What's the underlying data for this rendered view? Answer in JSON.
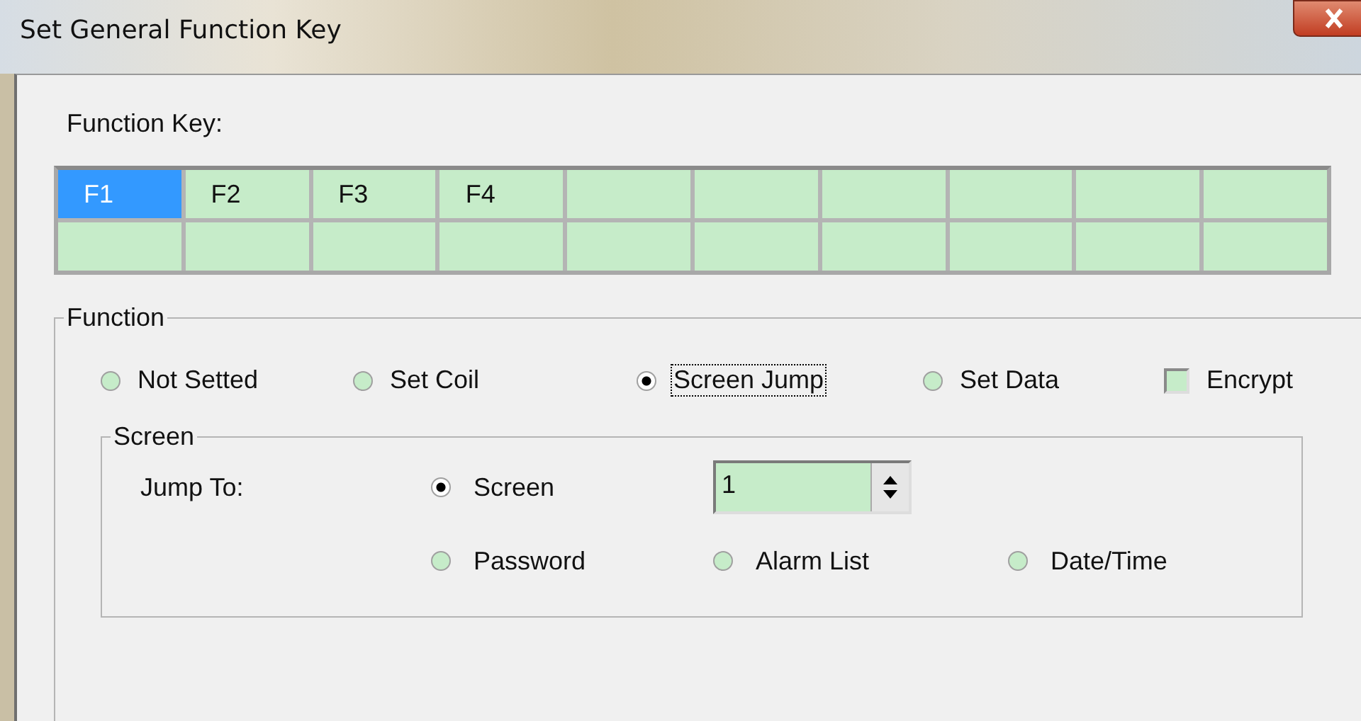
{
  "window": {
    "title": "Set General Function Key"
  },
  "function_key": {
    "label": "Function Key:",
    "rows": [
      [
        {
          "label": "F1",
          "selected": true
        },
        {
          "label": "F2",
          "selected": false
        },
        {
          "label": "F3",
          "selected": false
        },
        {
          "label": "F4",
          "selected": false
        },
        {
          "selected": false
        },
        {
          "selected": false
        },
        {
          "selected": false
        },
        {
          "selected": false
        },
        {
          "selected": false
        },
        {
          "selected": false
        }
      ],
      [
        {
          "selected": false
        },
        {
          "selected": false
        },
        {
          "selected": false
        },
        {
          "selected": false
        },
        {
          "selected": false
        },
        {
          "selected": false
        },
        {
          "selected": false
        },
        {
          "selected": false
        },
        {
          "selected": false
        },
        {
          "selected": false
        }
      ]
    ]
  },
  "function": {
    "title": "Function",
    "options": [
      {
        "label": "Not Setted",
        "selected": false,
        "focused": false
      },
      {
        "label": "Set Coil",
        "selected": false,
        "focused": false
      },
      {
        "label": "Screen Jump",
        "selected": true,
        "focused": true
      },
      {
        "label": "Set Data",
        "selected": false,
        "focused": false
      }
    ],
    "encrypt": {
      "label": "Encrypt",
      "checked": false
    },
    "screen": {
      "title": "Screen",
      "jump_to_label": "Jump To:",
      "options": [
        {
          "label": "Screen",
          "selected": true
        },
        {
          "label": "Password",
          "selected": false
        },
        {
          "label": "Alarm List",
          "selected": false
        },
        {
          "label": "Date/Time",
          "selected": false
        }
      ],
      "screen_number": {
        "value": "1"
      }
    }
  }
}
